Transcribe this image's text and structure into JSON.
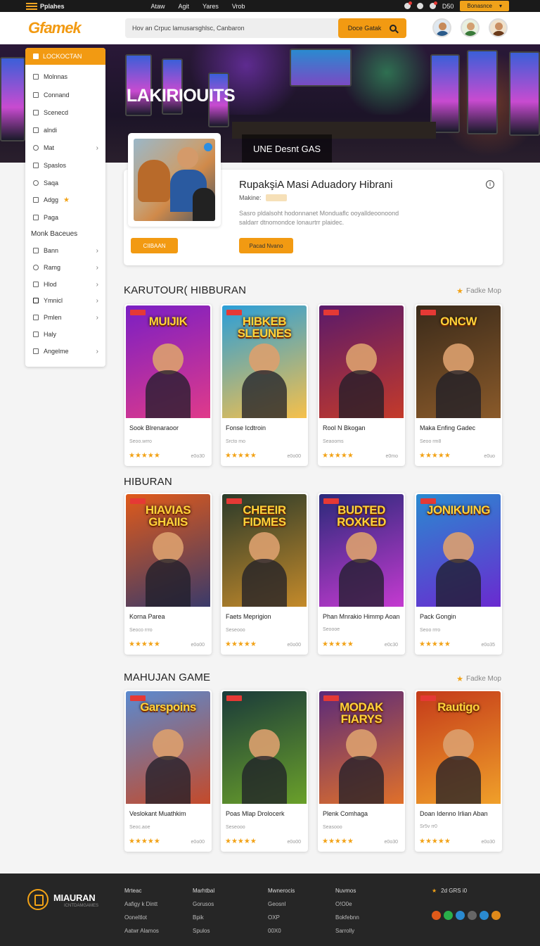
{
  "topbar": {
    "brand": "Pplahes",
    "links": [
      "Ataw",
      "Agit",
      "Yares",
      "Vrob"
    ],
    "count": "D50",
    "button": "Bonasnce"
  },
  "header": {
    "logo": "Gfamek",
    "search_placeholder": "Hov an Crpuc lamusarsghlsc, Canbaron",
    "search_button": "Doce Gatak"
  },
  "hero": {
    "title": "LAKIRIOUITS",
    "panel": "UNE Desnt GAS"
  },
  "sidebar": {
    "header": "LOCKOCTAN",
    "items": [
      "Molnnas",
      "Connand",
      "Scenecd",
      "alndi",
      "Mat",
      "Spaslos",
      "Saqa",
      "Adgg",
      "Paga"
    ],
    "section": "Monk Baceues",
    "section_items": [
      "Bann",
      "Ramg",
      "Hlod",
      "Ymnicl",
      "Pmlen",
      "Haly",
      "Angelme"
    ]
  },
  "featured": {
    "title": "RupakşiA Masi Aduadory Hibrani",
    "meta": "Makine:",
    "description": "Sasro pldalsoht hodonnanet Monduaflc ooyalldeoonoond saldarr dtnomondce lonaurtrr plaidec.",
    "button_primary": "CIIBAAN",
    "button_secondary": "Pacad Nvano"
  },
  "sections": [
    {
      "title": "KARUTOUR( HIBBURAN",
      "more": "Fadke Mop",
      "cards": [
        {
          "overlay": "MUIJIK",
          "name": "Sook Blrenaraoor",
          "sub": "Seoo.wrro",
          "count": "e0o30",
          "colors": [
            "#7a1fc4",
            "#e03a8a"
          ]
        },
        {
          "overlay": "HIBKEB SLEUNES",
          "name": "Fonse Icdtroin",
          "sub": "Srcto mo",
          "count": "e0o00",
          "colors": [
            "#2a9ed9",
            "#f6c04a"
          ]
        },
        {
          "overlay": "",
          "name": "Rool N Bkogan",
          "sub": "Seaooms",
          "count": "e0mo",
          "colors": [
            "#5a1a6a",
            "#c43a2a"
          ]
        },
        {
          "overlay": "ONCW",
          "name": "Maka Enfing Gadec",
          "sub": "Seoo rm8",
          "count": "e0uo",
          "colors": [
            "#3a2a1a",
            "#8a5a2a"
          ]
        }
      ]
    },
    {
      "title": "HIBURAN",
      "more": "",
      "cards": [
        {
          "overlay": "HIAVIAS GHAIIS",
          "name": "Korna Parea",
          "sub": "Seoco rrro",
          "count": "e0o00",
          "colors": [
            "#e05a1a",
            "#3a3a6a"
          ]
        },
        {
          "overlay": "CHEEIR FIDMES",
          "name": "Faets Meprigion",
          "sub": "Seseooo",
          "count": "e0o00",
          "colors": [
            "#2a3a2a",
            "#c48a2a"
          ]
        },
        {
          "overlay": "BUDTED ROXKED",
          "name": "Phan Mnrakio Himmp Aoan",
          "sub": "Seoooe",
          "count": "e0c30",
          "colors": [
            "#2a2a7a",
            "#c43ad0"
          ]
        },
        {
          "overlay": "JONIKUING",
          "name": "Pack Gongin",
          "sub": "Seoo rrro",
          "count": "e0o35",
          "colors": [
            "#2a8ad0",
            "#6a2ad0"
          ]
        }
      ]
    },
    {
      "title": "MAHUJAN GAME",
      "more": "Fadke Mop",
      "cards": [
        {
          "overlay": "Garspoins",
          "name": "Veslokant Muathkim",
          "sub": "Seoc.aoe",
          "count": "e0o00",
          "colors": [
            "#5a8ad0",
            "#c44a2a"
          ]
        },
        {
          "overlay": "",
          "name": "Poas Mlap Drolocerk",
          "sub": "Seseooo",
          "count": "e0o00",
          "colors": [
            "#1a3a3a",
            "#6aa02a"
          ]
        },
        {
          "overlay": "MODAK FIARYS",
          "name": "Plenk Comhaga",
          "sub": "Seasooo",
          "count": "e0o30",
          "colors": [
            "#5a2a7a",
            "#e0702a"
          ]
        },
        {
          "overlay": "Rautigo",
          "name": "Doan Idenno Irlian Aban",
          "sub": "Sr5v rr0",
          "count": "e0o30",
          "colors": [
            "#c43a1a",
            "#f0a02a"
          ]
        }
      ]
    }
  ],
  "footer": {
    "name": "MIAURAN",
    "tagline": "ICNTDAMGAMES",
    "columns": [
      [
        "Mrteac",
        "Aafigy k Dintt",
        "Ooneltlot",
        "Aatwr Alamos"
      ],
      [
        "Marhtbal",
        "Gorusos",
        "Bpik",
        "Spulos"
      ],
      [
        "Mwnerocis",
        "Geosnl",
        "OXP",
        "00X0"
      ],
      [
        "Nuvmos",
        "O!O0e",
        "Bokfebnn",
        "Sarrolly"
      ]
    ],
    "rating": "2d GRS i0",
    "social_colors": [
      "#e05a1a",
      "#2ab04a",
      "#2a8ad0",
      "#666666",
      "#2a8ad0",
      "#e08a1a"
    ]
  }
}
